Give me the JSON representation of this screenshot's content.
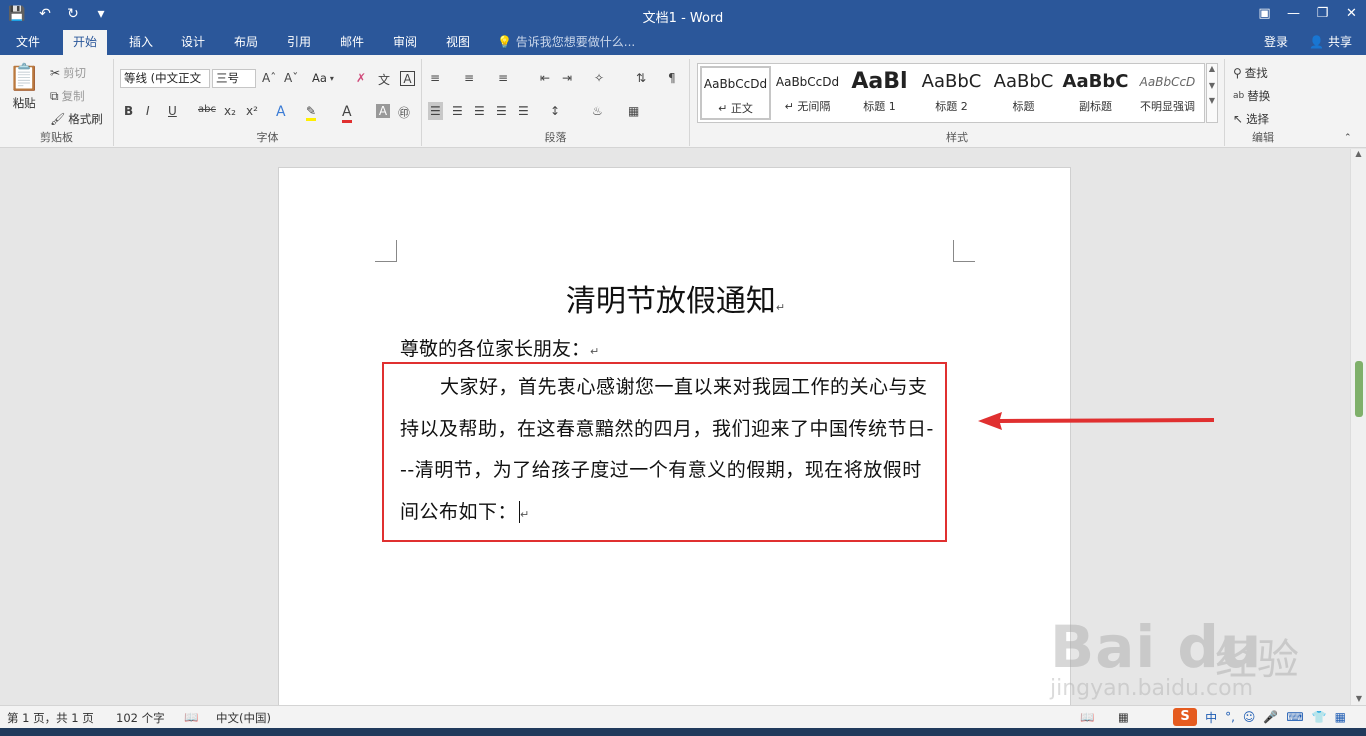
{
  "window": {
    "title": "文档1 - Word"
  },
  "tabs": [
    {
      "label": "文件"
    },
    {
      "label": "开始"
    },
    {
      "label": "插入"
    },
    {
      "label": "设计"
    },
    {
      "label": "布局"
    },
    {
      "label": "引用"
    },
    {
      "label": "邮件"
    },
    {
      "label": "审阅"
    },
    {
      "label": "视图"
    }
  ],
  "tellme": "告诉我您想要做什么...",
  "login": "登录",
  "share": "共享",
  "clipboard": {
    "paste": "粘贴",
    "cut": "剪切",
    "copy": "复制",
    "format_painter": "格式刷",
    "label": "剪贴板"
  },
  "font": {
    "name": "等线 (中文正文",
    "size": "三号",
    "case": "Aa",
    "label": "字体"
  },
  "paragraph": {
    "label": "段落"
  },
  "styles": {
    "label": "样式",
    "items": [
      {
        "sample": "AaBbCcDd",
        "name": "↵ 正文"
      },
      {
        "sample": "AaBbCcDd",
        "name": "↵ 无间隔"
      },
      {
        "sample": "AaBl",
        "name": "标题 1"
      },
      {
        "sample": "AaBbC",
        "name": "标题 2"
      },
      {
        "sample": "AaBbC",
        "name": "标题"
      },
      {
        "sample": "AaBbC",
        "name": "副标题"
      },
      {
        "sample": "AaBbCcD",
        "name": "不明显强调"
      }
    ]
  },
  "editing": {
    "find": "查找",
    "replace": "替换",
    "select": "选择",
    "label": "编辑"
  },
  "document": {
    "heading": "清明节放假通知",
    "salutation": "尊敬的各位家长朋友：",
    "body": "大家好，首先衷心感谢您一直以来对我园工作的关心与支持以及帮助，在这春意黯然的四月，我们迎来了中国传统节日---清明节，为了给孩子度过一个有意义的假期，现在将放假时间公布如下："
  },
  "status": {
    "page": "第 1 页，共 1 页",
    "words": "102 个字",
    "language": "中文(中国)"
  },
  "ime": {
    "mode": "中"
  },
  "watermark": {
    "brand": "Bai du",
    "cn": "经验",
    "url": "jingyan.baidu.com"
  },
  "colors": {
    "word_blue": "#2b579a",
    "annotation_red": "#e03030"
  }
}
